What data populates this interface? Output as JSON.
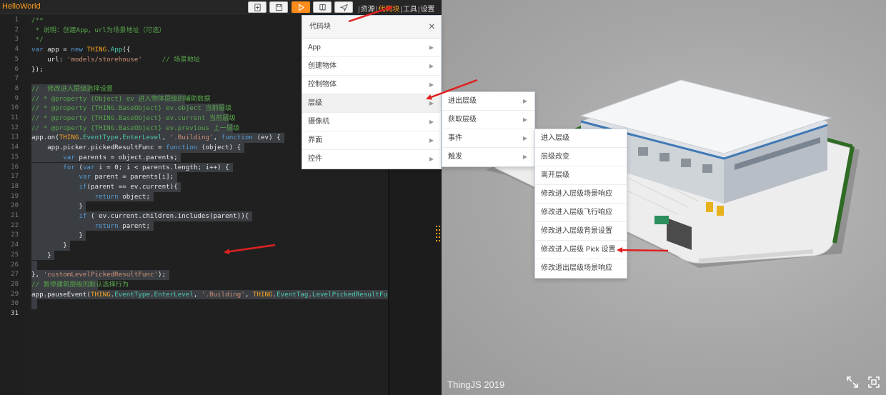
{
  "app": {
    "title": "HelloWorld"
  },
  "toolbar": {
    "buttons": [
      {
        "name": "new-file",
        "icon": "new-file-icon"
      },
      {
        "name": "save",
        "icon": "save-icon"
      },
      {
        "name": "run",
        "icon": "play-icon"
      },
      {
        "name": "share",
        "icon": "book-icon"
      },
      {
        "name": "publish",
        "icon": "send-icon"
      }
    ],
    "links": [
      {
        "label": "资源"
      },
      {
        "label": "代码块",
        "active": true
      },
      {
        "label": "工具"
      },
      {
        "label": "设置"
      }
    ]
  },
  "editor": {
    "current_line": "31",
    "line_numbers": [
      "1",
      "2",
      "3",
      "4",
      "5",
      "6",
      "7",
      "8",
      "9",
      "10",
      "11",
      "12",
      "13",
      "14",
      "15",
      "16",
      "17",
      "18",
      "19",
      "20",
      "21",
      "22",
      "23",
      "24",
      "25",
      "26",
      "27",
      "28",
      "29",
      "30",
      "31"
    ],
    "lines": [
      [
        [
          "cm",
          "/**"
        ]
      ],
      [
        [
          "cm",
          " * 说明：创建App，url为场景地址（可选）"
        ]
      ],
      [
        [
          "cm",
          " */"
        ]
      ],
      [
        [
          "kw",
          "var"
        ],
        [
          "tx",
          " app = "
        ],
        [
          "kw",
          "new "
        ],
        [
          "th",
          "THING"
        ],
        [
          "tx",
          "."
        ],
        [
          "pr",
          "App"
        ],
        [
          "tx",
          "({"
        ]
      ],
      [
        [
          "tx",
          "    url: "
        ],
        [
          "st",
          "'models/storehouse'"
        ],
        [
          "tx",
          "     "
        ],
        [
          "cm",
          "// 场景地址"
        ]
      ],
      [
        [
          "tx",
          "});"
        ]
      ],
      [],
      [
        [
          "cm",
          "//  修改进入层级选择设置"
        ]
      ],
      [
        [
          "cm",
          "// * @property {Object} ev 进入物体层级的辅助数据"
        ]
      ],
      [
        [
          "cm",
          "// * @property {THING.BaseObject} ev.object 当前层级"
        ]
      ],
      [
        [
          "cm",
          "// * @property {THING.BaseObject} ev.current 当前层级"
        ]
      ],
      [
        [
          "cm",
          "// * @property {THING.BaseObject} ev.previous 上一层级"
        ]
      ],
      [
        [
          "tx",
          "app.on("
        ],
        [
          "th",
          "THING"
        ],
        [
          "tx",
          "."
        ],
        [
          "pr",
          "EventType"
        ],
        [
          "tx",
          "."
        ],
        [
          "pr",
          "EnterLevel"
        ],
        [
          "tx",
          ", "
        ],
        [
          "st",
          "'.Building'"
        ],
        [
          "tx",
          ", "
        ],
        [
          "kw",
          "function"
        ],
        [
          "tx",
          " (ev) {"
        ]
      ],
      [
        [
          "tx",
          "    app.picker.pickedResultFunc = "
        ],
        [
          "kw",
          "function"
        ],
        [
          "tx",
          " (object) {"
        ]
      ],
      [
        [
          "tx",
          "        "
        ],
        [
          "kw",
          "var"
        ],
        [
          "tx",
          " parents = object.parents;"
        ]
      ],
      [
        [
          "tx",
          "        "
        ],
        [
          "kw",
          "for"
        ],
        [
          "tx",
          " ("
        ],
        [
          "kw",
          "var"
        ],
        [
          "tx",
          " i = 0; i < parents.length; i++) {"
        ]
      ],
      [
        [
          "tx",
          "            "
        ],
        [
          "kw",
          "var"
        ],
        [
          "tx",
          " parent = parents[i];"
        ]
      ],
      [
        [
          "tx",
          "            "
        ],
        [
          "kw",
          "if"
        ],
        [
          "tx",
          "(parent == ev.current){"
        ]
      ],
      [
        [
          "tx",
          "                "
        ],
        [
          "kw",
          "return"
        ],
        [
          "tx",
          " object;"
        ]
      ],
      [
        [
          "tx",
          "            }"
        ]
      ],
      [
        [
          "tx",
          "            "
        ],
        [
          "kw",
          "if"
        ],
        [
          "tx",
          " ( ev.current.children.includes(parent)){"
        ]
      ],
      [
        [
          "tx",
          "                "
        ],
        [
          "kw",
          "return"
        ],
        [
          "tx",
          " parent;"
        ]
      ],
      [
        [
          "tx",
          "            }"
        ]
      ],
      [
        [
          "tx",
          "        }"
        ]
      ],
      [
        [
          "tx",
          "    }"
        ]
      ],
      [],
      [
        [
          "tx",
          "}, "
        ],
        [
          "st",
          "'customLevelPickedResultFunc'"
        ],
        [
          "tx",
          ");"
        ]
      ],
      [
        [
          "cm",
          "// 暂停建筑层级的默认选择行为"
        ]
      ],
      [
        [
          "tx",
          "app.pauseEvent("
        ],
        [
          "th",
          "THING"
        ],
        [
          "tx",
          "."
        ],
        [
          "pr",
          "EventType"
        ],
        [
          "tx",
          "."
        ],
        [
          "pr",
          "EnterLevel"
        ],
        [
          "tx",
          ", "
        ],
        [
          "st",
          "'.Building'"
        ],
        [
          "tx",
          ", "
        ],
        [
          "th",
          "THING"
        ],
        [
          "tx",
          "."
        ],
        [
          "pr",
          "EventTag"
        ],
        [
          "tx",
          "."
        ],
        [
          "pr",
          "LevelPickedResultFu"
        ]
      ],
      [],
      []
    ]
  },
  "code_menu": {
    "title": "代码块",
    "items": [
      {
        "label": "App"
      },
      {
        "label": "创建物体"
      },
      {
        "label": "控制物体"
      },
      {
        "label": "层级",
        "highlighted": true
      },
      {
        "label": "摄像机"
      },
      {
        "label": "界面"
      },
      {
        "label": "控件"
      }
    ]
  },
  "level_menu": {
    "items": [
      {
        "label": "进出层级"
      },
      {
        "label": "获取层级"
      },
      {
        "label": "事件"
      },
      {
        "label": "触发"
      }
    ]
  },
  "event_menu": {
    "items": [
      {
        "label": "进入层级"
      },
      {
        "label": "层级改变"
      },
      {
        "label": "离开层级"
      },
      {
        "label": "修改进入层级场景响应"
      },
      {
        "label": "修改进入层级飞行响应"
      },
      {
        "label": "修改进入层级背景设置"
      },
      {
        "label": "修改进入层级 Pick 设置"
      },
      {
        "label": "修改退出层级场景响应"
      }
    ]
  },
  "viewport": {
    "brand": "ThingJS 2019",
    "icons": [
      "fullscreen-icon",
      "fit-view-icon"
    ],
    "accent_color": "#ff8c1a"
  }
}
